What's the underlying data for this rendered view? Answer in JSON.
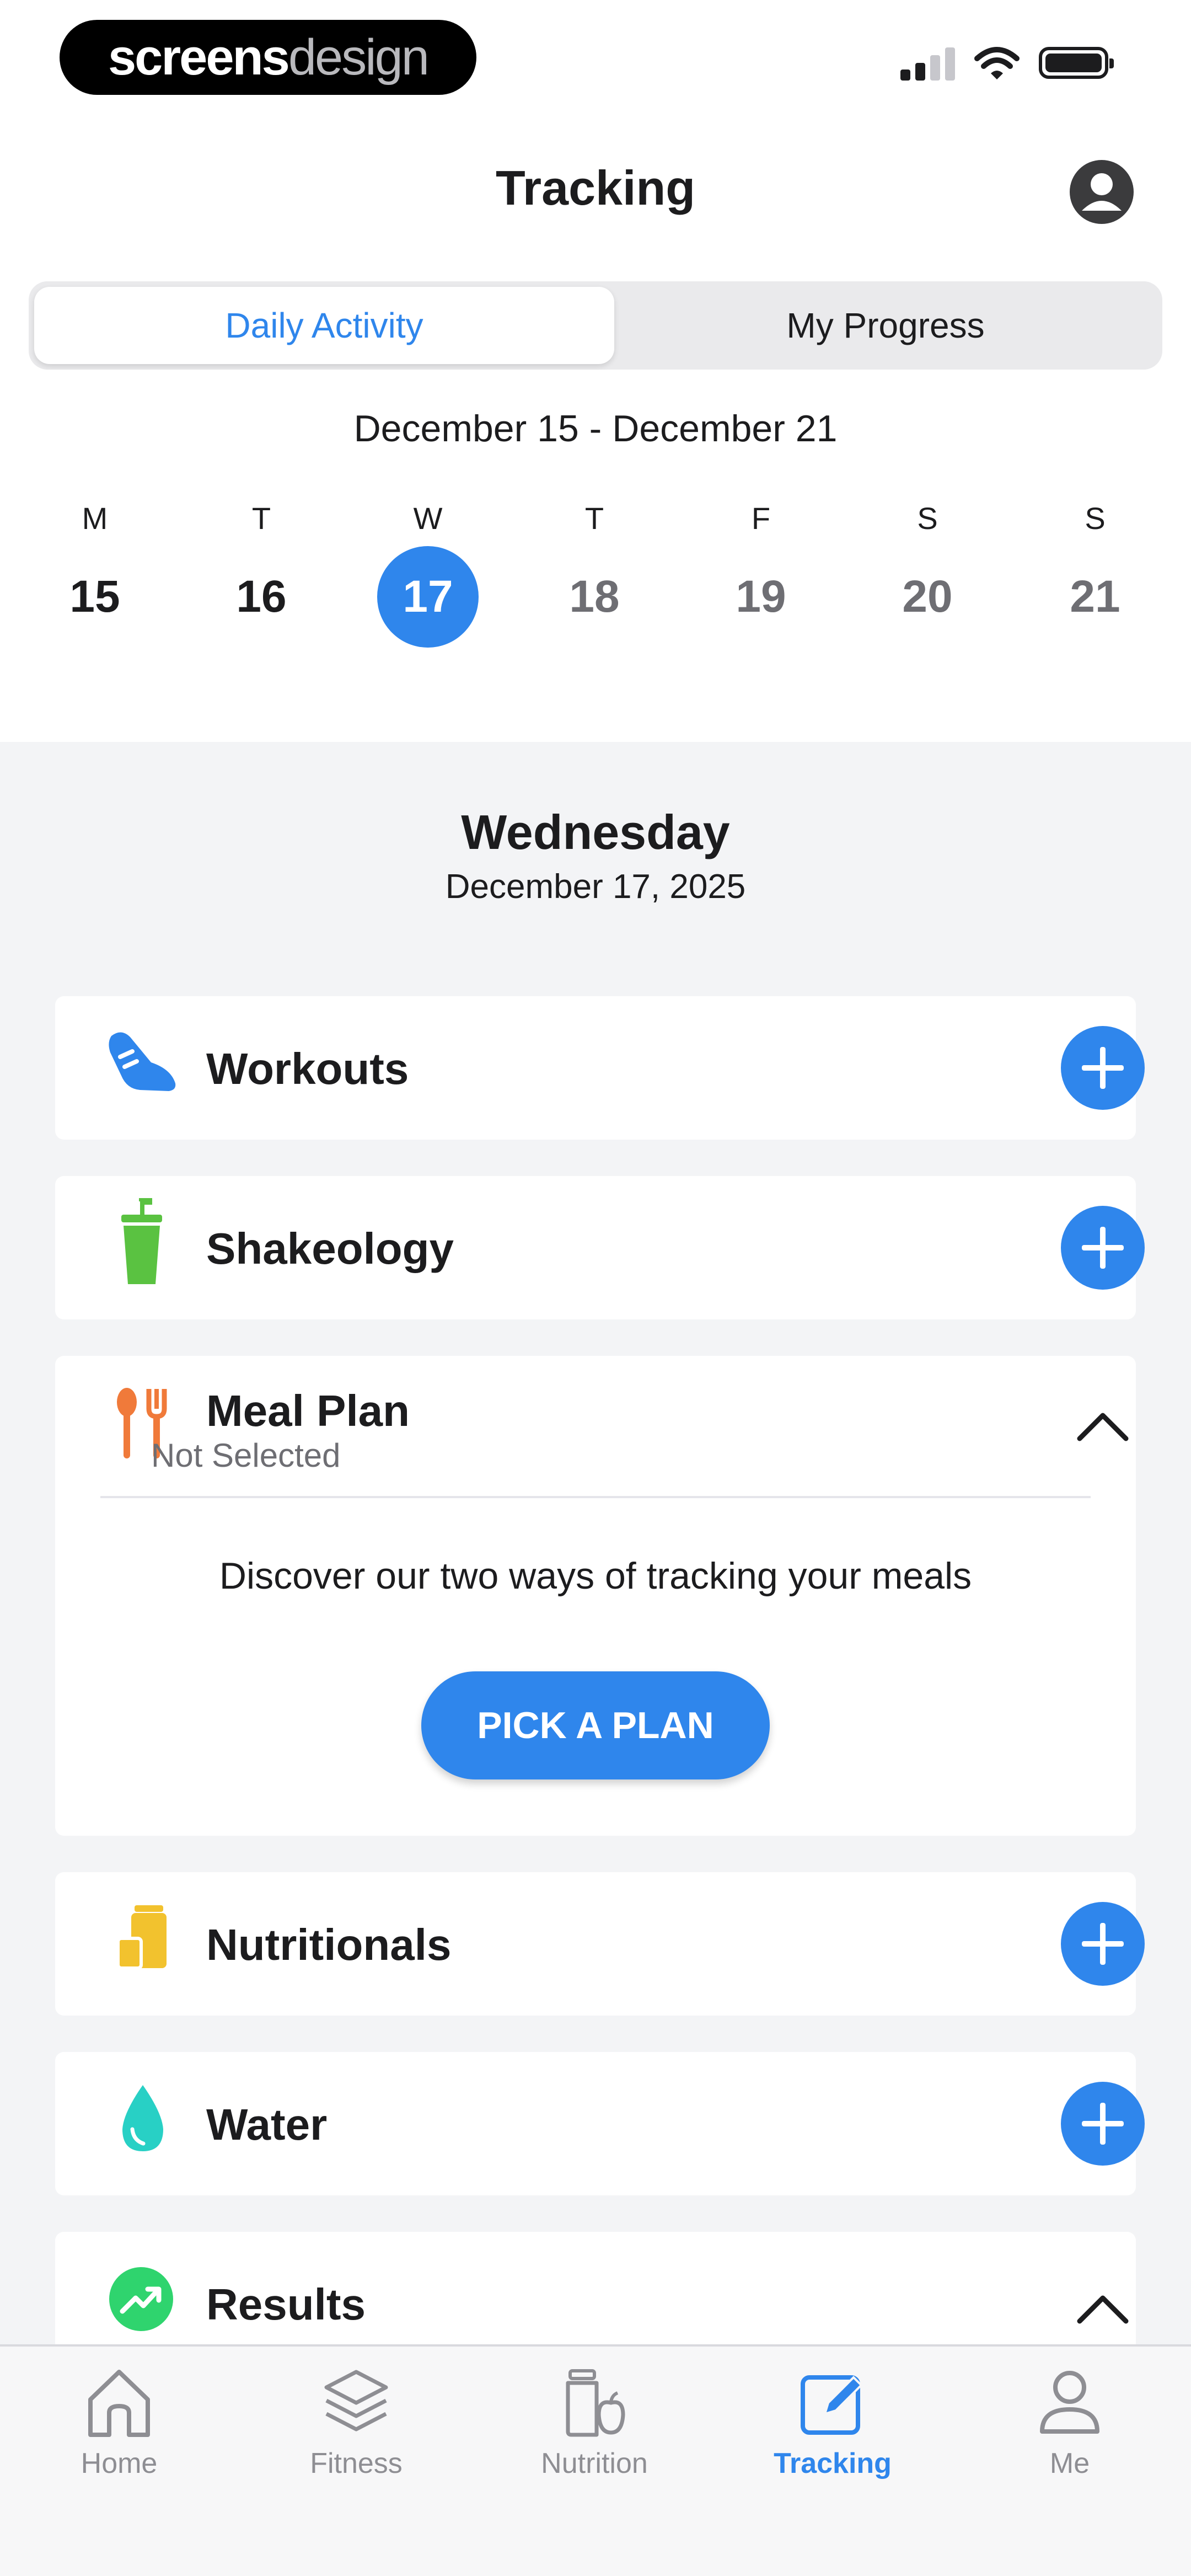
{
  "logo": {
    "part1": "screens",
    "part2": "design"
  },
  "header": {
    "title": "Tracking"
  },
  "segments": [
    "Daily Activity",
    "My Progress"
  ],
  "week": {
    "range": "December 15 - December 21",
    "days": [
      {
        "dow": "M",
        "num": "15"
      },
      {
        "dow": "T",
        "num": "16"
      },
      {
        "dow": "W",
        "num": "17"
      },
      {
        "dow": "T",
        "num": "18"
      },
      {
        "dow": "F",
        "num": "19"
      },
      {
        "dow": "S",
        "num": "20"
      },
      {
        "dow": "S",
        "num": "21"
      }
    ]
  },
  "selected_day": {
    "weekday": "Wednesday",
    "date": "December 17, 2025"
  },
  "cards": {
    "workouts": "Workouts",
    "shakeology": "Shakeology",
    "meal_plan": {
      "title": "Meal Plan",
      "status": "Not Selected",
      "message": "Discover our two ways of tracking your meals",
      "button": "PICK A PLAN"
    },
    "nutritionals": "Nutritionals",
    "water": "Water",
    "results": "Results"
  },
  "tabbar": [
    "Home",
    "Fitness",
    "Nutrition",
    "Tracking",
    "Me"
  ],
  "colors": {
    "accent": "#2f86ec",
    "workouts_icon": "#2f86ec",
    "shake_icon": "#5ac241",
    "meal_icon": "#f07a3a",
    "nutritionals_icon": "#f2c22e",
    "water_icon": "#28d0c5",
    "results_icon": "#2fd46e"
  }
}
